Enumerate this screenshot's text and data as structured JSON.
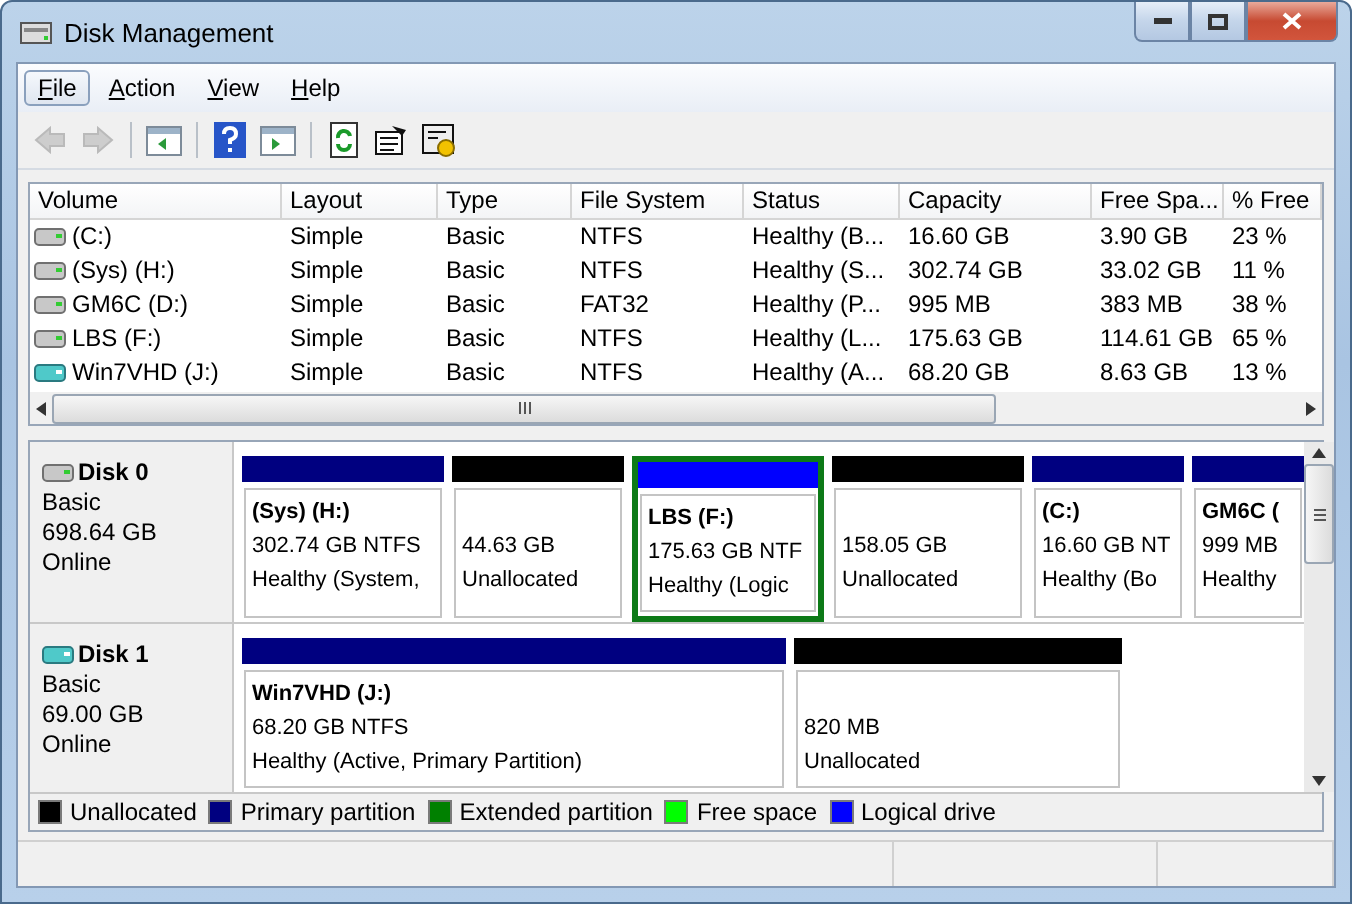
{
  "window": {
    "title": "Disk Management"
  },
  "menu": [
    {
      "label": "File",
      "selected": true
    },
    {
      "label": "Action",
      "selected": false
    },
    {
      "label": "View",
      "selected": false
    },
    {
      "label": "Help",
      "selected": false
    }
  ],
  "toolbar": [
    {
      "kind": "back",
      "disabled": true
    },
    {
      "kind": "forward",
      "disabled": true
    },
    {
      "kind": "separator"
    },
    {
      "kind": "tree",
      "disabled": false
    },
    {
      "kind": "separator"
    },
    {
      "kind": "help",
      "disabled": false
    },
    {
      "kind": "pane",
      "disabled": false
    },
    {
      "kind": "separator"
    },
    {
      "kind": "refresh",
      "disabled": false
    },
    {
      "kind": "properties",
      "disabled": false
    },
    {
      "kind": "settings",
      "disabled": false
    }
  ],
  "volumes": {
    "columns": [
      "Volume",
      "Layout",
      "Type",
      "File System",
      "Status",
      "Capacity",
      "Free Spa...",
      "% Free"
    ],
    "rows": [
      {
        "kind": "hdd",
        "cells": [
          " (C:)",
          "Simple",
          "Basic",
          "NTFS",
          "Healthy (B...",
          "16.60 GB",
          "3.90 GB",
          "23 %"
        ]
      },
      {
        "kind": "hdd",
        "cells": [
          "(Sys) (H:)",
          "Simple",
          "Basic",
          "NTFS",
          "Healthy (S...",
          "302.74 GB",
          "33.02 GB",
          "11 %"
        ]
      },
      {
        "kind": "hdd",
        "cells": [
          "GM6C (D:)",
          "Simple",
          "Basic",
          "FAT32",
          "Healthy (P...",
          "995 MB",
          "383 MB",
          "38 %"
        ]
      },
      {
        "kind": "hdd",
        "cells": [
          "LBS (F:)",
          "Simple",
          "Basic",
          "NTFS",
          "Healthy (L...",
          "175.63 GB",
          "114.61 GB",
          "65 %"
        ]
      },
      {
        "kind": "vhd",
        "cells": [
          "Win7VHD (J:)",
          "Simple",
          "Basic",
          "NTFS",
          "Healthy (A...",
          "68.20 GB",
          "8.63 GB",
          "13 %"
        ]
      }
    ]
  },
  "disks": [
    {
      "name": "Disk 0",
      "kind": "hdd",
      "type": "Basic",
      "size": "698.64 GB",
      "status": "Online",
      "partitions": [
        {
          "name": "(Sys)  (H:)",
          "size": "302.74 GB NTFS",
          "status": "Healthy (System,",
          "color": "#000080",
          "selected": false
        },
        {
          "size": "44.63 GB",
          "status": "Unallocated",
          "color": "#000000",
          "selected": false
        },
        {
          "name": "LBS  (F:)",
          "size": "175.63 GB NTF",
          "status": "Healthy (Logic",
          "color": "#0000ff",
          "selected": true
        },
        {
          "size": "158.05 GB",
          "status": "Unallocated",
          "color": "#000000",
          "selected": false
        },
        {
          "name": "(C:)",
          "size": "16.60 GB NT",
          "status": "Healthy (Bo",
          "color": "#000080",
          "selected": false
        },
        {
          "name": "GM6C (",
          "size": "999 MB",
          "status": "Healthy",
          "color": "#000080",
          "selected": false
        }
      ]
    },
    {
      "name": "Disk 1",
      "kind": "vhd",
      "type": "Basic",
      "size": "69.00 GB",
      "status": "Online",
      "partitions": [
        {
          "name": "Win7VHD  (J:)",
          "size": "68.20 GB NTFS",
          "status": "Healthy (Active, Primary Partition)",
          "color": "#000080",
          "selected": false
        },
        {
          "size": "820 MB",
          "status": "Unallocated",
          "color": "#000000",
          "selected": false
        }
      ]
    }
  ],
  "legend": [
    {
      "label": "Unallocated",
      "color": "#000000"
    },
    {
      "label": "Primary partition",
      "color": "#000080"
    },
    {
      "label": "Extended partition",
      "color": "#008000"
    },
    {
      "label": "Free space",
      "color": "#00ff00"
    },
    {
      "label": "Logical drive",
      "color": "#0000ff"
    }
  ]
}
